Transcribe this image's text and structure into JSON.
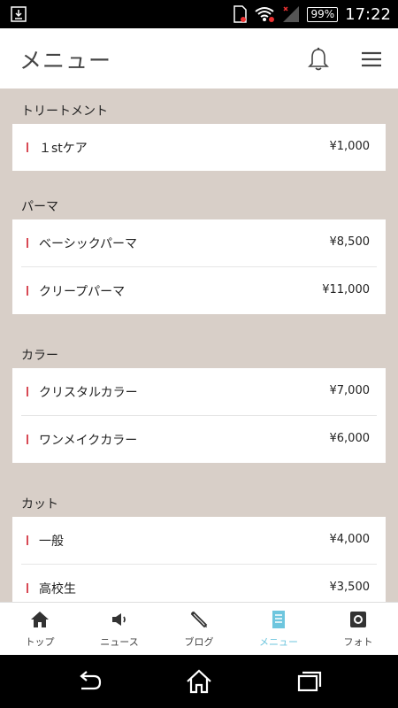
{
  "status_bar": {
    "battery": "99%",
    "time": "17:22"
  },
  "app_bar": {
    "title": "メニュー"
  },
  "sections": [
    {
      "title": "トリートメント",
      "items": [
        {
          "name": "１stケア",
          "price": "¥1,000"
        }
      ]
    },
    {
      "title": "パーマ",
      "items": [
        {
          "name": "ベーシックパーマ",
          "price": "¥8,500"
        },
        {
          "name": "クリープパーマ",
          "price": "¥11,000"
        }
      ]
    },
    {
      "title": "カラー",
      "items": [
        {
          "name": "クリスタルカラー",
          "price": "¥7,000"
        },
        {
          "name": "ワンメイクカラー",
          "price": "¥6,000"
        }
      ]
    },
    {
      "title": "カット",
      "items": [
        {
          "name": "一般",
          "price": "¥4,000"
        },
        {
          "name": "高校生",
          "price": "¥3,500"
        }
      ]
    }
  ],
  "tabs": [
    {
      "label": "トップ",
      "icon": "home-icon"
    },
    {
      "label": "ニュース",
      "icon": "megaphone-icon"
    },
    {
      "label": "ブログ",
      "icon": "pencil-icon"
    },
    {
      "label": "メニュー",
      "icon": "document-icon",
      "active": true
    },
    {
      "label": "フォト",
      "icon": "camera-icon"
    }
  ],
  "colors": {
    "background": "#d8cfc8",
    "accent_bar": "#d84a55",
    "active_tab": "#6ec6de"
  }
}
